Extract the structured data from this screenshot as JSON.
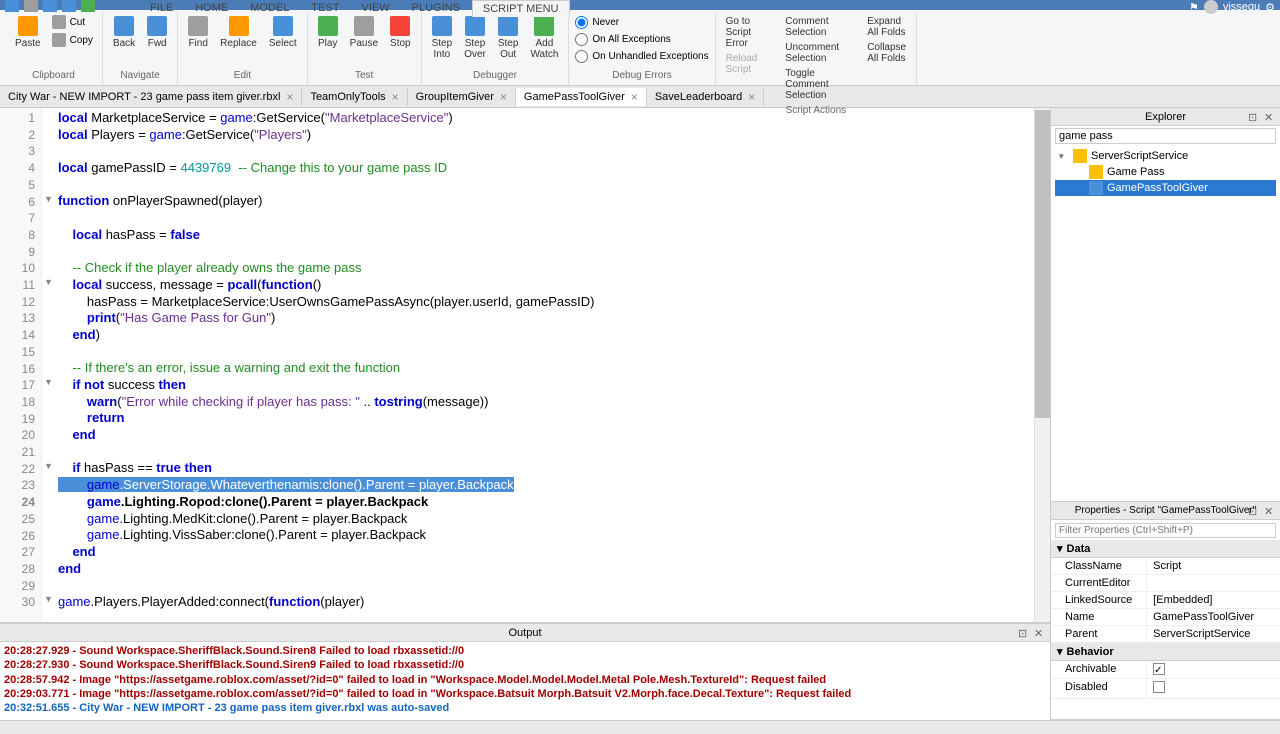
{
  "menubar": {
    "tabs": [
      "FILE",
      "HOME",
      "MODEL",
      "TEST",
      "VIEW",
      "PLUGINS",
      "SCRIPT MENU"
    ],
    "active_tab": "SCRIPT MENU",
    "username": "vissequ"
  },
  "ribbon": {
    "clipboard": {
      "label": "Clipboard",
      "cut": "Cut",
      "copy": "Copy",
      "paste": "Paste"
    },
    "navigate": {
      "label": "Navigate",
      "back": "Back",
      "fwd": "Fwd"
    },
    "edit": {
      "label": "Edit",
      "find": "Find",
      "replace": "Replace",
      "select": "Select"
    },
    "test": {
      "label": "Test",
      "play": "Play",
      "pause": "Pause",
      "stop": "Stop"
    },
    "debugger": {
      "label": "Debugger",
      "step_into": "Step\nInto",
      "step_over": "Step\nOver",
      "step_out": "Step\nOut",
      "add": "Add\nWatch"
    },
    "debug_errors": {
      "label": "Debug Errors",
      "never": "Never",
      "all_exc": "On All Exceptions",
      "unhandled": "On Unhandled Exceptions"
    },
    "other": {
      "goto": "Go to Script Error",
      "reload": "Reload Script",
      "comment": "Comment Selection",
      "uncomment": "Uncomment Selection",
      "toggle_comment": "Toggle Comment Selection",
      "expand_folds": "Expand All Folds",
      "collapse_folds": "Collapse All Folds",
      "script_actions": "Script Actions"
    }
  },
  "doctabs": [
    {
      "label": "City War - NEW IMPORT - 23 game pass item giver.rbxl",
      "closable": true
    },
    {
      "label": "TeamOnlyTools",
      "closable": true
    },
    {
      "label": "GroupItemGiver",
      "closable": true
    },
    {
      "label": "GamePassToolGiver",
      "closable": true,
      "active": true
    },
    {
      "label": "SaveLeaderboard",
      "closable": true
    }
  ],
  "code_lines": [
    {
      "n": 1,
      "seg": [
        [
          "kw",
          "local"
        ],
        [
          "id",
          " MarketplaceService = "
        ],
        [
          "gl",
          "game"
        ],
        [
          "id",
          ":GetService("
        ],
        [
          "str",
          "\"MarketplaceService\""
        ],
        [
          "id",
          ")"
        ]
      ]
    },
    {
      "n": 2,
      "seg": [
        [
          "kw",
          "local"
        ],
        [
          "id",
          " Players = "
        ],
        [
          "gl",
          "game"
        ],
        [
          "id",
          ":GetService("
        ],
        [
          "str",
          "\"Players\""
        ],
        [
          "id",
          ")"
        ]
      ]
    },
    {
      "n": 3,
      "seg": []
    },
    {
      "n": 4,
      "seg": [
        [
          "kw",
          "local"
        ],
        [
          "id",
          " gamePassID = "
        ],
        [
          "num",
          "4439769"
        ],
        [
          "id",
          "  "
        ],
        [
          "com",
          "-- Change this to your game pass ID"
        ]
      ]
    },
    {
      "n": 5,
      "seg": []
    },
    {
      "n": 6,
      "fold": true,
      "seg": [
        [
          "kw",
          "function"
        ],
        [
          "id",
          " onPlayerSpawned(player)"
        ]
      ]
    },
    {
      "n": 7,
      "seg": []
    },
    {
      "n": 8,
      "seg": [
        [
          "id",
          "    "
        ],
        [
          "kw",
          "local"
        ],
        [
          "id",
          " hasPass = "
        ],
        [
          "kw",
          "false"
        ]
      ]
    },
    {
      "n": 9,
      "seg": []
    },
    {
      "n": 10,
      "seg": [
        [
          "id",
          "    "
        ],
        [
          "com",
          "-- Check if the player already owns the game pass"
        ]
      ]
    },
    {
      "n": 11,
      "fold": true,
      "seg": [
        [
          "id",
          "    "
        ],
        [
          "kw",
          "local"
        ],
        [
          "id",
          " success, message = "
        ],
        [
          "kw",
          "pcall"
        ],
        [
          "id",
          "("
        ],
        [
          "kw",
          "function"
        ],
        [
          "id",
          "()"
        ]
      ]
    },
    {
      "n": 12,
      "seg": [
        [
          "id",
          "        hasPass = MarketplaceService:UserOwnsGamePassAsync(player.userId, gamePassID)"
        ]
      ]
    },
    {
      "n": 13,
      "seg": [
        [
          "id",
          "        "
        ],
        [
          "kw",
          "print"
        ],
        [
          "id",
          "("
        ],
        [
          "str",
          "\"Has Game Pass for Gun\""
        ],
        [
          "id",
          ")"
        ]
      ]
    },
    {
      "n": 14,
      "seg": [
        [
          "id",
          "    "
        ],
        [
          "kw",
          "end"
        ],
        [
          "id",
          ")"
        ]
      ]
    },
    {
      "n": 15,
      "seg": []
    },
    {
      "n": 16,
      "seg": [
        [
          "id",
          "    "
        ],
        [
          "com",
          "-- If there's an error, issue a warning and exit the function"
        ]
      ]
    },
    {
      "n": 17,
      "fold": true,
      "seg": [
        [
          "id",
          "    "
        ],
        [
          "kw",
          "if"
        ],
        [
          "id",
          " "
        ],
        [
          "kw",
          "not"
        ],
        [
          "id",
          " success "
        ],
        [
          "kw",
          "then"
        ]
      ]
    },
    {
      "n": 18,
      "seg": [
        [
          "id",
          "        "
        ],
        [
          "kw",
          "warn"
        ],
        [
          "id",
          "("
        ],
        [
          "str",
          "\"Error while checking if player has pass: \""
        ],
        [
          "id",
          " .. "
        ],
        [
          "kw",
          "tostring"
        ],
        [
          "id",
          "(message))"
        ]
      ]
    },
    {
      "n": 19,
      "seg": [
        [
          "id",
          "        "
        ],
        [
          "kw",
          "return"
        ]
      ]
    },
    {
      "n": 20,
      "seg": [
        [
          "id",
          "    "
        ],
        [
          "kw",
          "end"
        ]
      ]
    },
    {
      "n": 21,
      "seg": []
    },
    {
      "n": 22,
      "fold": true,
      "seg": [
        [
          "id",
          "    "
        ],
        [
          "kw",
          "if"
        ],
        [
          "id",
          " hasPass == "
        ],
        [
          "kw",
          "true"
        ],
        [
          "id",
          " "
        ],
        [
          "kw",
          "then"
        ]
      ]
    },
    {
      "n": 23,
      "selected": true,
      "seg": [
        [
          "id",
          "        "
        ],
        [
          "gl",
          "game"
        ],
        [
          "id",
          ".ServerStorage.Whateverthenamis:clone().Parent = player.Backpack"
        ]
      ]
    },
    {
      "n": 24,
      "current": true,
      "seg": [
        [
          "id",
          "        "
        ],
        [
          "gl",
          "game"
        ],
        [
          "id",
          ".Lighting.Ropod:clone().Parent = player.Backpack"
        ]
      ]
    },
    {
      "n": 25,
      "seg": [
        [
          "id",
          "        "
        ],
        [
          "gl",
          "game"
        ],
        [
          "id",
          ".Lighting.MedKit:clone().Parent = player.Backpack"
        ]
      ]
    },
    {
      "n": 26,
      "seg": [
        [
          "id",
          "        "
        ],
        [
          "gl",
          "game"
        ],
        [
          "id",
          ".Lighting.VissSaber:clone().Parent = player.Backpack"
        ]
      ]
    },
    {
      "n": 27,
      "seg": [
        [
          "id",
          "    "
        ],
        [
          "kw",
          "end"
        ]
      ]
    },
    {
      "n": 28,
      "seg": [
        [
          "kw",
          "end"
        ]
      ]
    },
    {
      "n": 29,
      "seg": []
    },
    {
      "n": 30,
      "fold": true,
      "seg": [
        [
          "gl",
          "game"
        ],
        [
          "id",
          ".Players.PlayerAdded:connect("
        ],
        [
          "kw",
          "function"
        ],
        [
          "id",
          "(player)"
        ]
      ]
    }
  ],
  "output": {
    "title": "Output",
    "lines": [
      {
        "cls": "err",
        "text": "20:28:27.929 - Sound Workspace.SheriffBlack.Sound.Siren8 Failed to load rbxassetid://0"
      },
      {
        "cls": "err",
        "text": "20:28:27.930 - Sound Workspace.SheriffBlack.Sound.Siren9 Failed to load rbxassetid://0"
      },
      {
        "cls": "err",
        "text": "20:28:57.942 - Image \"https://assetgame.roblox.com/asset/?id=0\" failed to load in \"Workspace.Model.Model.Model.Metal Pole.Mesh.TextureId\": Request failed"
      },
      {
        "cls": "err",
        "text": "20:29:03.771 - Image \"https://assetgame.roblox.com/asset/?id=0\" failed to load in \"Workspace.Batsuit Morph.Batsuit V2.Morph.face.Decal.Texture\": Request failed"
      },
      {
        "cls": "info",
        "text": "20:32:51.655 - City War - NEW IMPORT - 23 game pass item giver.rbxl was auto-saved"
      }
    ]
  },
  "explorer": {
    "title": "Explorer",
    "filter": "game pass",
    "nodes": [
      {
        "depth": 0,
        "arrow": "▾",
        "icon": "folder",
        "label": "ServerScriptService"
      },
      {
        "depth": 1,
        "arrow": "",
        "icon": "folder",
        "label": "Game Pass"
      },
      {
        "depth": 1,
        "arrow": "",
        "icon": "script",
        "label": "GamePassToolGiver",
        "selected": true
      }
    ]
  },
  "properties": {
    "title": "Properties - Script \"GamePassToolGiver\"",
    "filter_placeholder": "Filter Properties (Ctrl+Shift+P)",
    "sections": [
      {
        "name": "Data",
        "rows": [
          {
            "k": "ClassName",
            "v": "Script"
          },
          {
            "k": "CurrentEditor",
            "v": ""
          },
          {
            "k": "LinkedSource",
            "v": "[Embedded]"
          },
          {
            "k": "Name",
            "v": "GamePassToolGiver"
          },
          {
            "k": "Parent",
            "v": "ServerScriptService"
          }
        ]
      },
      {
        "name": "Behavior",
        "rows": [
          {
            "k": "Archivable",
            "v": "",
            "check": true
          },
          {
            "k": "Disabled",
            "v": "",
            "check": false
          }
        ]
      }
    ]
  }
}
